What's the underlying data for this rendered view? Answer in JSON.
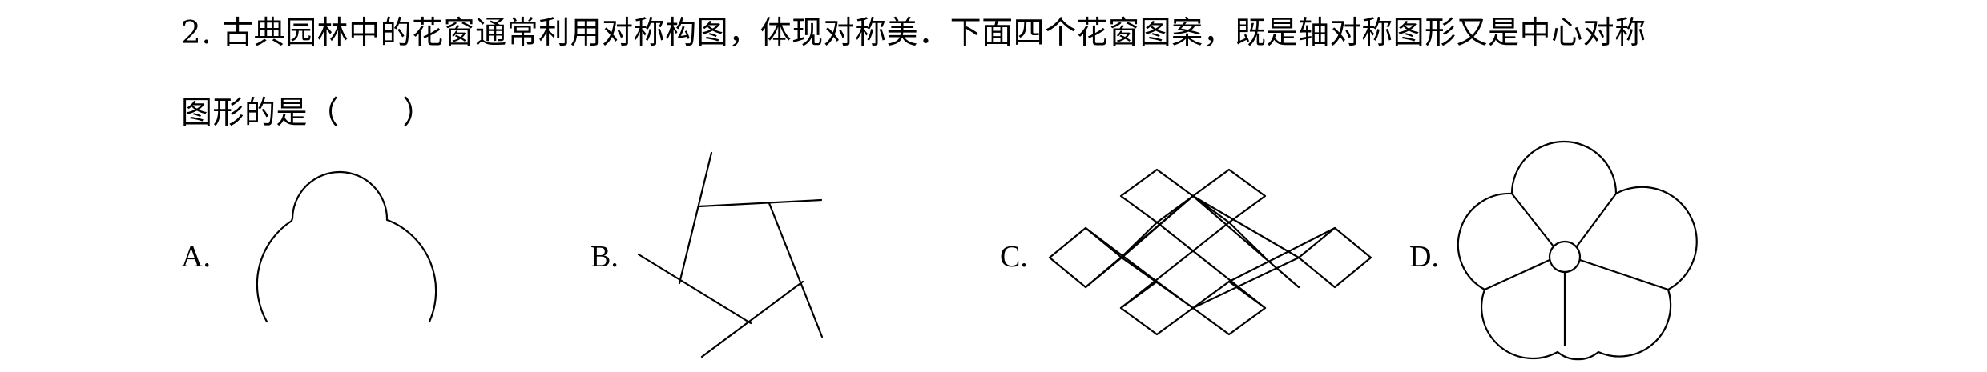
{
  "question": {
    "line1": "2. 古典园林中的花窗通常利用对称构图，体现对称美．下面四个花窗图案，既是轴对称图形又是中心对称",
    "line2": "图形的是（　　）"
  },
  "options": [
    {
      "label": "A.",
      "figure": "scalloped-arch-window"
    },
    {
      "label": "B.",
      "figure": "pinwheel-pentagon-window"
    },
    {
      "label": "C.",
      "figure": "rhombus-lattice-window"
    },
    {
      "label": "D.",
      "figure": "five-petal-plum-window"
    }
  ]
}
